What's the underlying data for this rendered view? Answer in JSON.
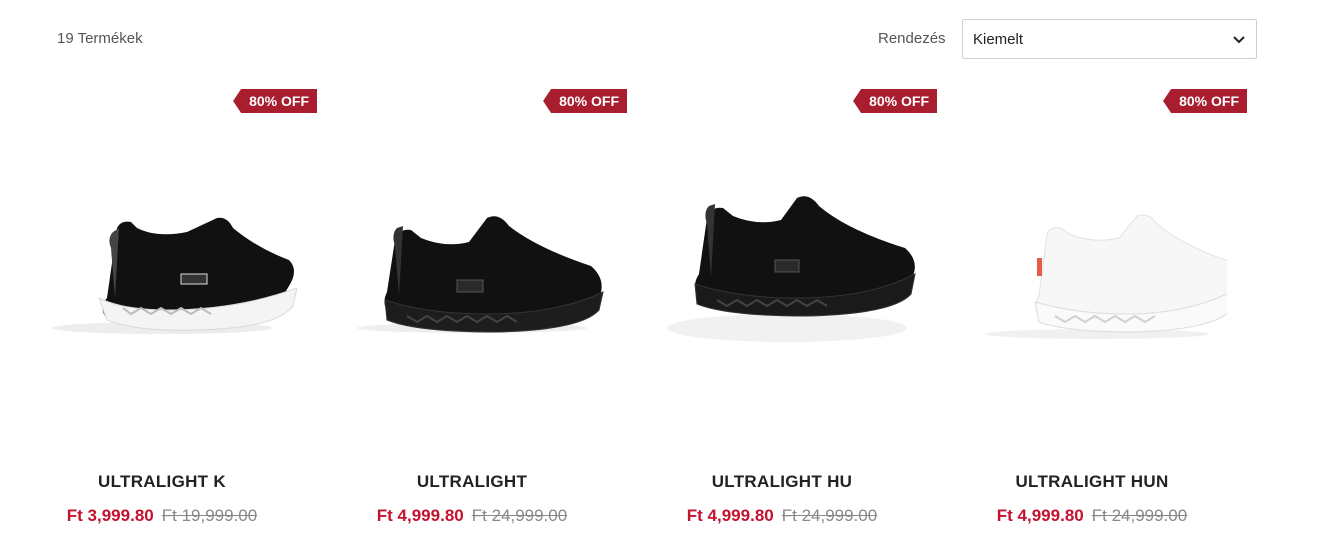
{
  "toolbar": {
    "count": "19 Termékek",
    "sort_label": "Rendezés",
    "sort_value": "Kiemelt"
  },
  "products": [
    {
      "title": "ULTRALIGHT K",
      "badge": "80% OFF",
      "price": "Ft 3,999.80",
      "old_price": "Ft 19,999.00",
      "color": "black-white-sole"
    },
    {
      "title": "ULTRALIGHT",
      "badge": "80% OFF",
      "price": "Ft 4,999.80",
      "old_price": "Ft 24,999.00",
      "color": "black"
    },
    {
      "title": "ULTRALIGHT HU",
      "badge": "80% OFF",
      "price": "Ft 4,999.80",
      "old_price": "Ft 24,999.00",
      "color": "black"
    },
    {
      "title": "ULTRALIGHT HUN",
      "badge": "80% OFF",
      "price": "Ft 4,999.80",
      "old_price": "Ft 24,999.00",
      "color": "white"
    }
  ],
  "colors": {
    "badge": "#a91e2e",
    "sale_price": "#c4122f",
    "old_price": "#888888"
  }
}
